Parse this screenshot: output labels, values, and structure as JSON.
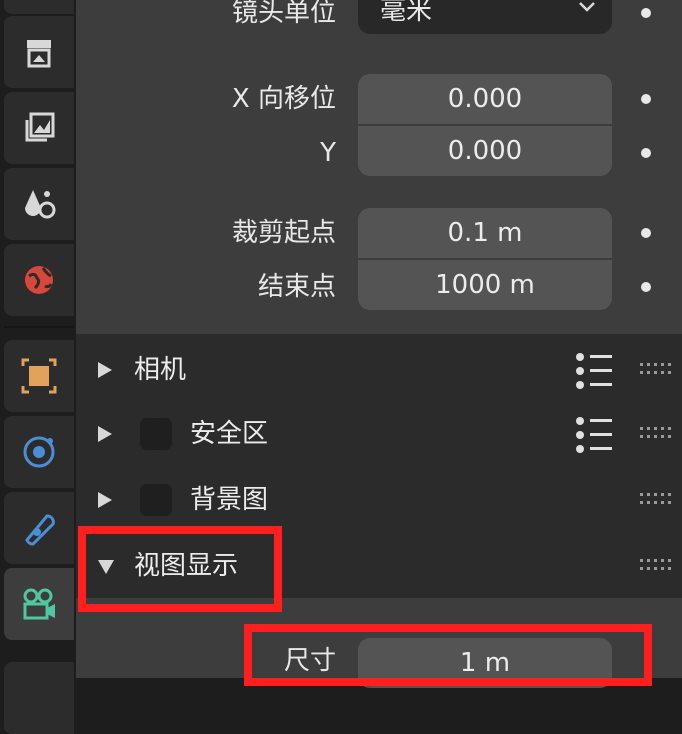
{
  "properties": {
    "lens_unit_label": "镜头单位",
    "lens_unit_value": "毫米",
    "shift_x_label": "X 向移位",
    "shift_x_value": "0.000",
    "shift_y_label": "Y",
    "shift_y_value": "0.000",
    "clip_start_label": "裁剪起点",
    "clip_start_value": "0.1 m",
    "clip_end_label": "结束点",
    "clip_end_value": "1000 m"
  },
  "sections": {
    "camera": "相机",
    "safe_areas": "安全区",
    "background_images": "背景图",
    "viewport_display": "视图显示"
  },
  "viewport_display": {
    "size_label": "尺寸",
    "size_value": "1 m"
  },
  "colors": {
    "highlight": "#ff1f1f",
    "panel": "#3d3d3d",
    "field": "#545454"
  },
  "tab_icons": [
    "render-icon",
    "output-icon",
    "view-layer-icon",
    "scene-icon",
    "world-icon",
    "object-icon",
    "physics-icon",
    "constraints-icon",
    "camera-data-icon"
  ]
}
